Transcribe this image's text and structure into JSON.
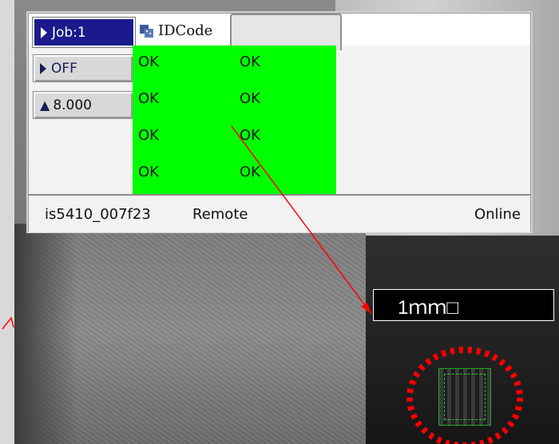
{
  "job_button": {
    "label": "Job:1"
  },
  "mode_button": {
    "label": "OFF"
  },
  "value_button": {
    "label": "8.000"
  },
  "tab": {
    "label": "IDCode"
  },
  "results": [
    [
      "OK",
      "OK"
    ],
    [
      "OK",
      "OK"
    ],
    [
      "OK",
      "OK"
    ],
    [
      "OK",
      "OK"
    ]
  ],
  "status": {
    "device": "is5410_007f23",
    "mode": "Remote",
    "connection": "Online"
  },
  "annotation": {
    "label": "1ｍｍ□"
  },
  "colors": {
    "grid": "#00ff00",
    "job": "#1a1a8c",
    "arrow": "#ff0000"
  }
}
